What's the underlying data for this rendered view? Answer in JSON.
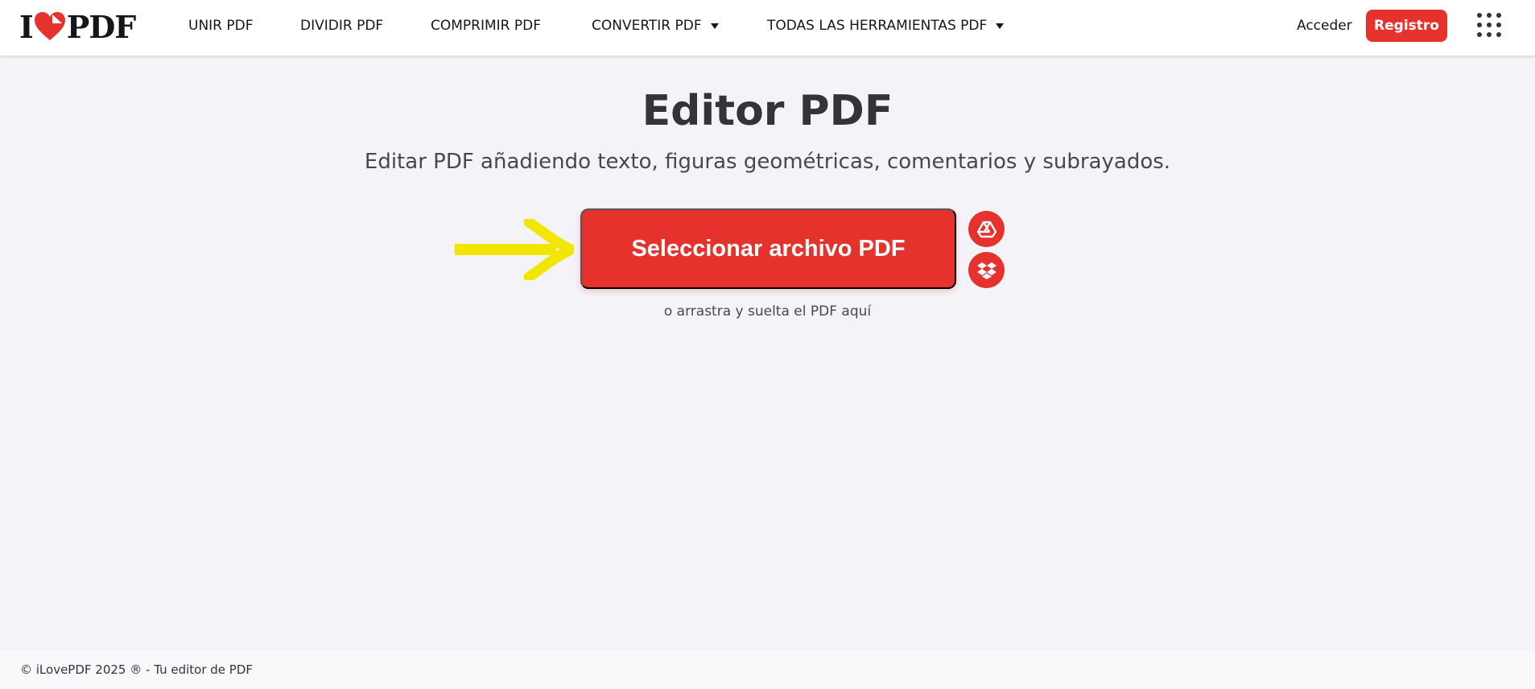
{
  "header": {
    "logo_left": "I",
    "logo_right": "PDF",
    "nav": [
      {
        "label": "UNIR PDF"
      },
      {
        "label": "DIVIDIR PDF"
      },
      {
        "label": "COMPRIMIR PDF"
      },
      {
        "label": "CONVERTIR PDF",
        "dropdown": true
      },
      {
        "label": "TODAS LAS HERRAMIENTAS PDF",
        "dropdown": true
      }
    ],
    "login_label": "Acceder",
    "register_label": "Registro",
    "apps_icon": "grid-menu-icon"
  },
  "main": {
    "title": "Editor PDF",
    "subtitle": "Editar PDF añadiendo texto, figuras geométricas, comentarios y subrayados.",
    "select_button_label": "Seleccionar archivo PDF",
    "drop_hint": "o arrastra y suelta el PDF aquí",
    "cloud_buttons": [
      "google-drive-icon",
      "dropbox-icon"
    ]
  },
  "footer": {
    "text": "© iLovePDF 2025 ® - Tu editor de PDF"
  },
  "colors": {
    "brand_red": "#e5322d",
    "background": "#f4f4f8",
    "text_dark": "#33333b",
    "annotation_arrow": "#f2e600"
  }
}
